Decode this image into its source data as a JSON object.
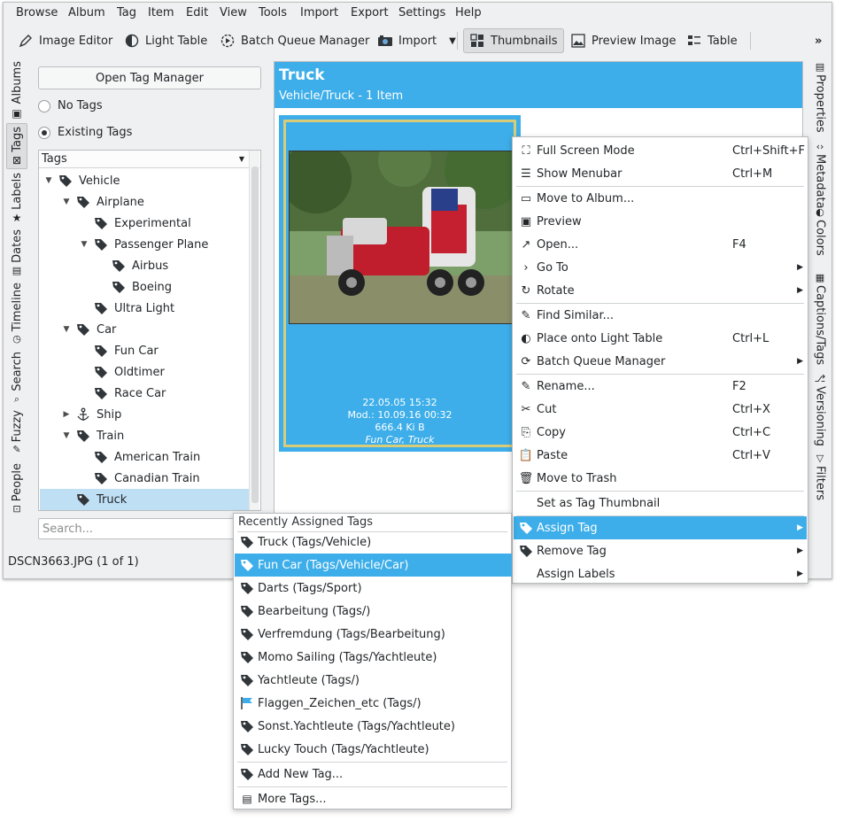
{
  "menubar": [
    "Browse",
    "Album",
    "Tag",
    "Item",
    "Edit",
    "View",
    "Tools",
    "Import",
    "Export",
    "Settings",
    "Help"
  ],
  "toolbar": {
    "image_editor": "Image Editor",
    "light_table": "Light Table",
    "batch_queue": "Batch Queue Manager",
    "import": "Import",
    "thumbnails": "Thumbnails",
    "preview_image": "Preview Image",
    "table": "Table",
    "overflow": "»"
  },
  "left_tabs": [
    "Albums",
    "Tags",
    "Labels",
    "Dates",
    "Timeline",
    "Search",
    "Fuzzy",
    "People"
  ],
  "right_tabs": [
    "Properties",
    "Metadata",
    "Colors",
    "Captions/Tags",
    "Versioning",
    "Filters"
  ],
  "tag_panel": {
    "open_manager": "Open Tag Manager",
    "no_tags": "No Tags",
    "existing_tags": "Existing Tags",
    "header": "Tags",
    "search_placeholder": "Search...",
    "items": [
      {
        "label": "Vehicle",
        "depth": 0,
        "exp": "▼"
      },
      {
        "label": "Airplane",
        "depth": 1,
        "exp": "▼"
      },
      {
        "label": "Experimental",
        "depth": 2,
        "exp": ""
      },
      {
        "label": "Passenger Plane",
        "depth": 2,
        "exp": "▼"
      },
      {
        "label": "Airbus",
        "depth": 3,
        "exp": ""
      },
      {
        "label": "Boeing",
        "depth": 3,
        "exp": ""
      },
      {
        "label": "Ultra Light",
        "depth": 2,
        "exp": ""
      },
      {
        "label": "Car",
        "depth": 1,
        "exp": "▼"
      },
      {
        "label": "Fun Car",
        "depth": 2,
        "exp": ""
      },
      {
        "label": "Oldtimer",
        "depth": 2,
        "exp": ""
      },
      {
        "label": "Race Car",
        "depth": 2,
        "exp": ""
      },
      {
        "label": "Ship",
        "depth": 1,
        "exp": "▶"
      },
      {
        "label": "Train",
        "depth": 1,
        "exp": "▼"
      },
      {
        "label": "American Train",
        "depth": 2,
        "exp": ""
      },
      {
        "label": "Canadian Train",
        "depth": 2,
        "exp": ""
      },
      {
        "label": "Truck",
        "depth": 1,
        "exp": ""
      }
    ]
  },
  "status": "DSCN3663.JPG (1 of 1)",
  "content": {
    "title": "Truck",
    "subtitle": "Vehicle/Truck - 1 Item",
    "meta": [
      "22.05.05 15:32",
      "Mod.: 10.09.16 00:32",
      "666.4 Ki B",
      "Fun Car, Truck"
    ]
  },
  "context_menu": [
    {
      "label": "Full Screen Mode",
      "shortcut": "Ctrl+Shift+F",
      "icon": "fullscreen-icon"
    },
    {
      "label": "Show Menubar",
      "shortcut": "Ctrl+M",
      "icon": "menubar-icon"
    },
    {
      "sep": true
    },
    {
      "label": "Move to Album...",
      "icon": "move-icon"
    },
    {
      "label": "Preview",
      "icon": "preview-icon"
    },
    {
      "label": "Open...",
      "shortcut": "F4",
      "icon": "open-icon"
    },
    {
      "label": "Go To",
      "sub": true,
      "icon": "goto-icon"
    },
    {
      "label": "Rotate",
      "sub": true,
      "icon": "rotate-icon"
    },
    {
      "sep": true
    },
    {
      "label": "Find Similar...",
      "icon": "find-similar-icon"
    },
    {
      "label": "Place onto Light Table",
      "shortcut": "Ctrl+L",
      "icon": "light-table-icon"
    },
    {
      "label": "Batch Queue Manager",
      "sub": true,
      "icon": "batch-icon"
    },
    {
      "sep": true
    },
    {
      "label": "Rename...",
      "shortcut": "F2",
      "icon": "rename-icon"
    },
    {
      "label": "Cut",
      "shortcut": "Ctrl+X",
      "icon": "cut-icon"
    },
    {
      "label": "Copy",
      "shortcut": "Ctrl+C",
      "icon": "copy-icon"
    },
    {
      "label": "Paste",
      "shortcut": "Ctrl+V",
      "icon": "paste-icon"
    },
    {
      "label": "Move to Trash",
      "icon": "trash-icon"
    },
    {
      "sep": true
    },
    {
      "label": "Set as Tag Thumbnail",
      "icon": ""
    },
    {
      "sep": true
    },
    {
      "label": "Assign Tag",
      "sub": true,
      "icon": "tag-icon",
      "hl": true
    },
    {
      "label": "Remove Tag",
      "sub": true,
      "icon": "tag-icon"
    },
    {
      "label": "Assign Labels",
      "sub": true,
      "icon": ""
    }
  ],
  "tag_submenu": {
    "title": "Recently Assigned Tags",
    "items": [
      {
        "label": "Truck (Tags/Vehicle)",
        "icon": "tag-icon"
      },
      {
        "label": "Fun Car (Tags/Vehicle/Car)",
        "icon": "tag-icon",
        "hl": true
      },
      {
        "label": "Darts (Tags/Sport)",
        "icon": "tag-icon"
      },
      {
        "label": "Bearbeitung (Tags/)",
        "icon": "tag-icon"
      },
      {
        "label": "Verfremdung (Tags/Bearbeitung)",
        "icon": "tag-icon"
      },
      {
        "label": "Momo Sailing (Tags/Yachtleute)",
        "icon": "tag-icon"
      },
      {
        "label": "Yachtleute (Tags/)",
        "icon": "tag-icon"
      },
      {
        "label": "Flaggen_Zeichen_etc (Tags/)",
        "icon": "flag-icon"
      },
      {
        "label": "Sonst.Yachtleute (Tags/Yachtleute)",
        "icon": "tag-icon"
      },
      {
        "label": "Lucky Touch (Tags/Yachtleute)",
        "icon": "tag-icon"
      }
    ],
    "add_new": "Add New Tag...",
    "more": "More Tags..."
  },
  "colors": {
    "accent": "#3daee9",
    "selection": "#bfdff5",
    "frame": "#d8cc79"
  }
}
